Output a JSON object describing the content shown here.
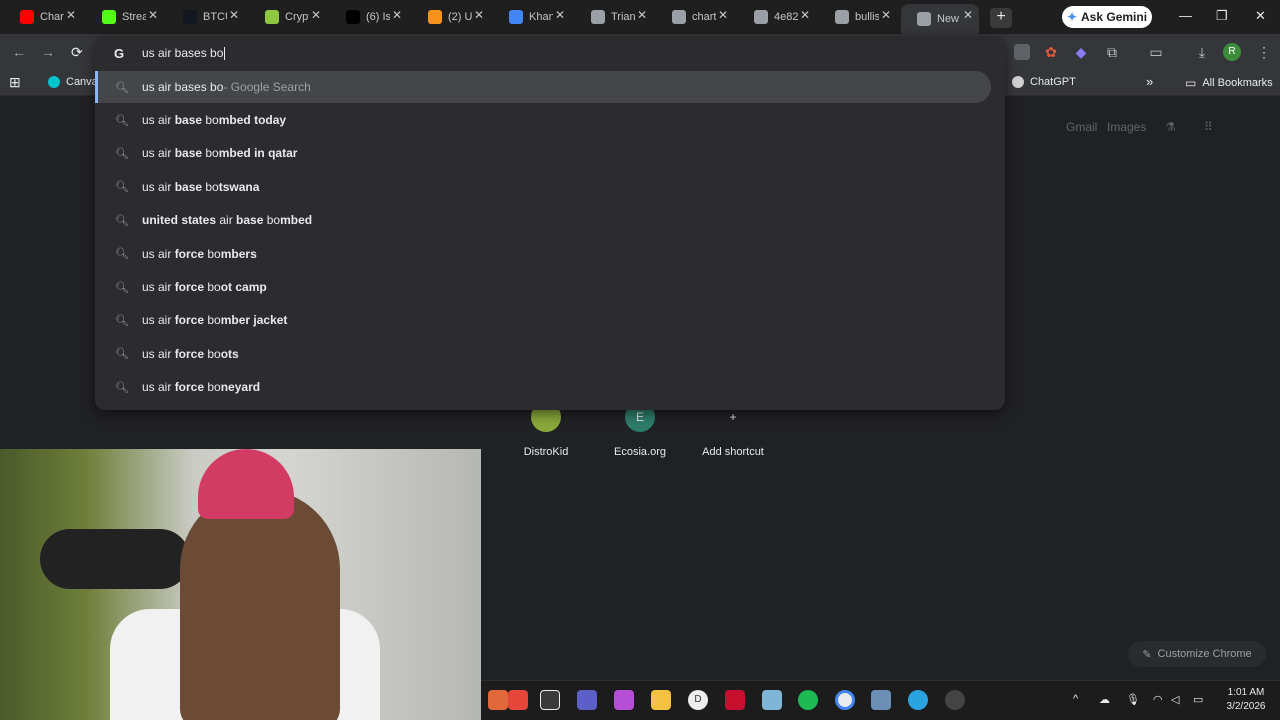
{
  "tabs": [
    {
      "title": "Chan",
      "favicon_color": "#ff0000"
    },
    {
      "title": "Strea",
      "favicon_color": "#53fc18"
    },
    {
      "title": "BTCU",
      "favicon_color": "#131722"
    },
    {
      "title": "Crypt",
      "favicon_color": "#8dc63f"
    },
    {
      "title": "(6) Is",
      "favicon_color": "#000000"
    },
    {
      "title": "(2) U",
      "favicon_color": "#f7931a"
    },
    {
      "title": "Khan",
      "favicon_color": "#4285f4"
    },
    {
      "title": "Trian",
      "favicon_color": "#9aa0a6"
    },
    {
      "title": "chart",
      "favicon_color": "#9aa0a6"
    },
    {
      "title": "4e82",
      "favicon_color": "#9aa0a6"
    },
    {
      "title": "bullis",
      "favicon_color": "#9aa0a6"
    },
    {
      "title": "New",
      "favicon_color": "#9aa0a6",
      "active": true
    }
  ],
  "header": {
    "new_tab_symbol": "+",
    "gemini_label": "Ask Gemini",
    "min_symbol": "—",
    "restore_symbol": "❐",
    "close_symbol": "✕"
  },
  "toolbar": {
    "back_symbol": "←",
    "forward_symbol": "→",
    "reload_symbol": "⟳",
    "avatar_letter": "R",
    "menu_symbol": "⋮"
  },
  "bookmarks": {
    "apps_symbol": "⊞",
    "canva": "Canva",
    "chatgpt": "ChatGPT",
    "more_symbol": "»",
    "all_bookmarks": "All Bookmarks"
  },
  "omnibox": {
    "g_logo": "G",
    "query": "us air bases bo",
    "top_suggestion": {
      "text": "us air bases bo",
      "suffix": " - Google Search"
    },
    "suggestions": [
      {
        "pre": "us air ",
        "bold1": "base",
        "mid": " bo",
        "bold2": "mbed today"
      },
      {
        "pre": "us air ",
        "bold1": "base",
        "mid": " bo",
        "bold2": "mbed in qatar"
      },
      {
        "pre": "us air ",
        "bold1": "base",
        "mid": " bo",
        "bold2": "tswana"
      },
      {
        "pre": "",
        "bold1": "united states",
        "mid": " air ",
        "bold2": "base",
        "mid2": " bo",
        "bold3": "mbed"
      },
      {
        "pre": "us air ",
        "bold1": "force",
        "mid": " bo",
        "bold2": "mbers"
      },
      {
        "pre": "us air ",
        "bold1": "force",
        "mid": " bo",
        "bold2": "ot camp"
      },
      {
        "pre": "us air ",
        "bold1": "force",
        "mid": " bo",
        "bold2": "mber jacket"
      },
      {
        "pre": "us air ",
        "bold1": "force",
        "mid": " bo",
        "bold2": "ots"
      },
      {
        "pre": "us air ",
        "bold1": "force",
        "mid": " bo",
        "bold2": "neyard"
      }
    ]
  },
  "page": {
    "gmail": "Gmail",
    "images": "Images",
    "shortcuts": [
      {
        "label": "DistroKid",
        "icon_text": "",
        "color": "#8aa83a"
      },
      {
        "label": "Ecosia.org",
        "icon_text": "E",
        "color": "#2e7d6b"
      },
      {
        "label": "Add shortcut",
        "icon_text": "+",
        "color": "#202124"
      }
    ],
    "customize_label": "Customize Chrome",
    "customize_icon": "✎"
  },
  "taskbar": {
    "time": "1:01 AM",
    "date": "3/2/2026",
    "tray_chevron": "^"
  }
}
